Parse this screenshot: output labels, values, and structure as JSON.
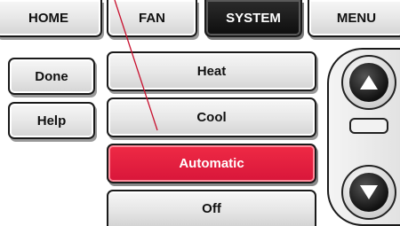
{
  "tabs": {
    "home": "HOME",
    "fan": "FAN",
    "system": "SYSTEM",
    "menu": "MENU"
  },
  "left_buttons": {
    "done": "Done",
    "help": "Help"
  },
  "modes": [
    {
      "label": "Heat"
    },
    {
      "label": "Cool"
    },
    {
      "label": "Automatic"
    },
    {
      "label": "Off"
    }
  ],
  "selected_mode": "Automatic",
  "icons": {
    "up": "up-arrow-icon",
    "down": "down-arrow-icon"
  },
  "colors": {
    "selected": "#e01f3f",
    "active_tab": "#111111"
  }
}
